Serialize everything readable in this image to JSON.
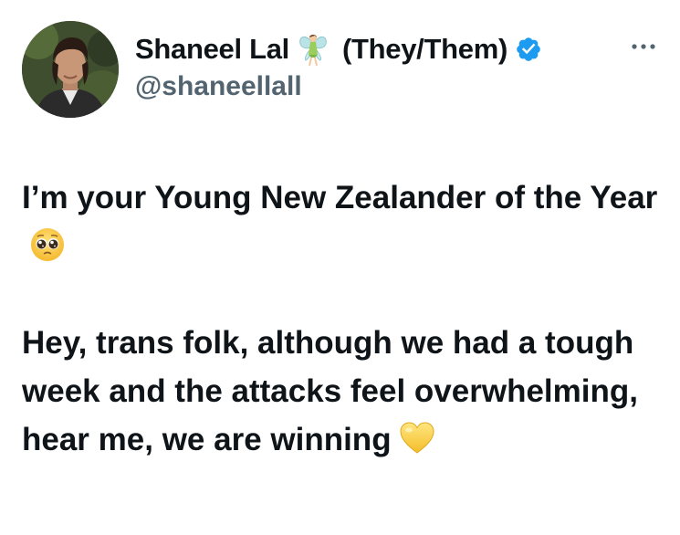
{
  "tweet": {
    "author": {
      "display_name": "Shaneel Lal",
      "name_emoji": "fairy-emoji",
      "pronouns": "(They/Them)",
      "handle": "@shaneellall",
      "verified": true,
      "verified_color": "#1d9bf0"
    },
    "paragraphs": [
      {
        "text": "I’m your Young New Zealander of the Year",
        "emoji": "pleading-face-emoji"
      },
      {
        "text": "Hey, trans folk, although we had a tough week and the attacks feel overwhelming, hear me, we are winning",
        "emoji": "yellow-heart-emoji"
      }
    ],
    "more_icon": "more-horizontal-icon"
  },
  "colors": {
    "text": "#0f1419",
    "secondary_text": "#536471",
    "accent": "#1d9bf0"
  }
}
